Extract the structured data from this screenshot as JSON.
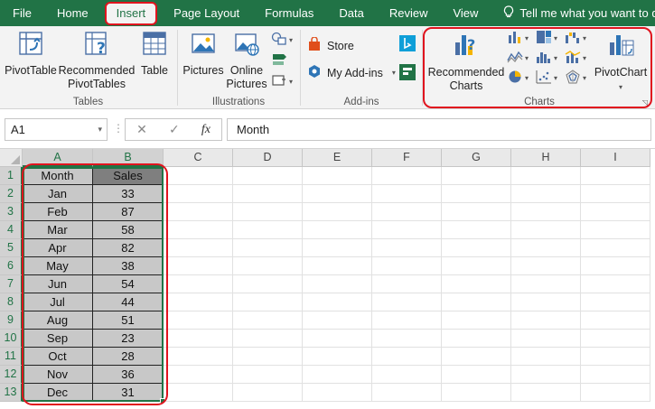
{
  "tabs": [
    {
      "label": "File",
      "active": false
    },
    {
      "label": "Home",
      "active": false
    },
    {
      "label": "Insert",
      "active": true
    },
    {
      "label": "Page Layout",
      "active": false
    },
    {
      "label": "Formulas",
      "active": false
    },
    {
      "label": "Data",
      "active": false
    },
    {
      "label": "Review",
      "active": false
    },
    {
      "label": "View",
      "active": false
    }
  ],
  "tell_me": "Tell me what you want to do...",
  "ribbon": {
    "tables": {
      "group_label": "Tables",
      "pivot_table": "PivotTable",
      "recommended_line1": "Recommended",
      "recommended_line2": "PivotTables",
      "table": "Table"
    },
    "illustrations": {
      "group_label": "Illustrations",
      "pictures": "Pictures",
      "online_line1": "Online",
      "online_line2": "Pictures"
    },
    "addins": {
      "group_label": "Add-ins",
      "store": "Store",
      "my_addins": "My Add-ins"
    },
    "charts": {
      "group_label": "Charts",
      "recommended_line1": "Recommended",
      "recommended_line2": "Charts",
      "pivot_chart": "PivotChart"
    }
  },
  "formula_bar": {
    "name_box": "A1",
    "fx": "fx",
    "content": "Month"
  },
  "columns": [
    "A",
    "B",
    "C",
    "D",
    "E",
    "F",
    "G",
    "H",
    "I"
  ],
  "rows": [
    "1",
    "2",
    "3",
    "4",
    "5",
    "6",
    "7",
    "8",
    "9",
    "10",
    "11",
    "12",
    "13"
  ],
  "table": {
    "headers": [
      "Month",
      "Sales"
    ],
    "data": [
      [
        "Jan",
        "33"
      ],
      [
        "Feb",
        "87"
      ],
      [
        "Mar",
        "58"
      ],
      [
        "Apr",
        "82"
      ],
      [
        "May",
        "38"
      ],
      [
        "Jun",
        "54"
      ],
      [
        "Jul",
        "44"
      ],
      [
        "Aug",
        "51"
      ],
      [
        "Sep",
        "23"
      ],
      [
        "Oct",
        "28"
      ],
      [
        "Nov",
        "36"
      ],
      [
        "Dec",
        "31"
      ]
    ]
  },
  "colors": {
    "excel_green": "#217346",
    "highlight_red": "#e0141e",
    "cell_gray": "#c8c8c8",
    "header_dark_gray": "#7f7f7f"
  }
}
